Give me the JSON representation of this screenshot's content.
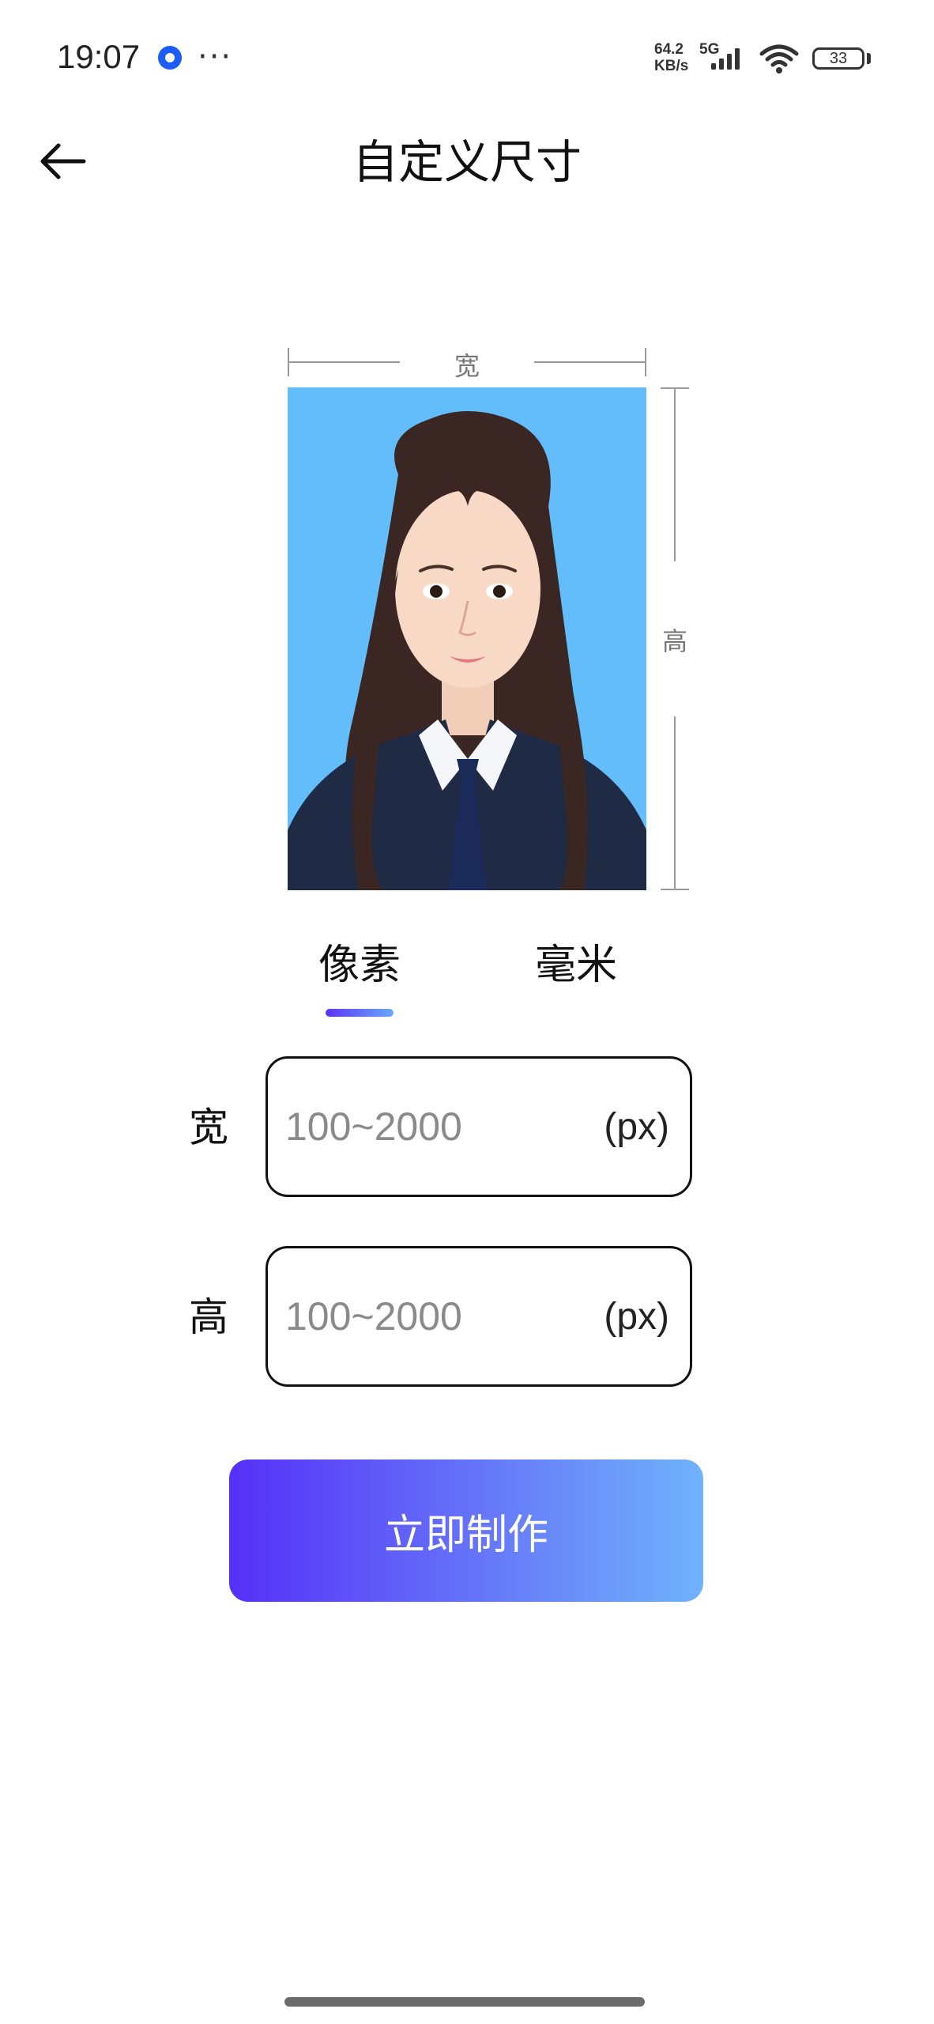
{
  "status_bar": {
    "time": "19:07",
    "app_icon": "browser-app-icon",
    "more_indicator": "···",
    "network_speed_line1": "64.2",
    "network_speed_line2": "KB/s",
    "network_type": "5G",
    "battery_level": "33"
  },
  "header": {
    "back_icon": "arrow-left-icon",
    "title": "自定义尺寸"
  },
  "diagram": {
    "width_label": "宽",
    "height_label": "高",
    "photo_background_color": "#62bdfa"
  },
  "tabs": [
    {
      "label": "像素",
      "selected": true
    },
    {
      "label": "毫米",
      "selected": false
    }
  ],
  "form": {
    "width": {
      "label": "宽",
      "placeholder": "100~2000",
      "value": "",
      "unit": "(px)"
    },
    "height": {
      "label": "高",
      "placeholder": "100~2000",
      "value": "",
      "unit": "(px)"
    }
  },
  "cta": {
    "label": "立即制作",
    "gradient_start": "#5630f8",
    "gradient_end": "#6fb2fb"
  },
  "colors": {
    "accent": "#5a34f5"
  }
}
